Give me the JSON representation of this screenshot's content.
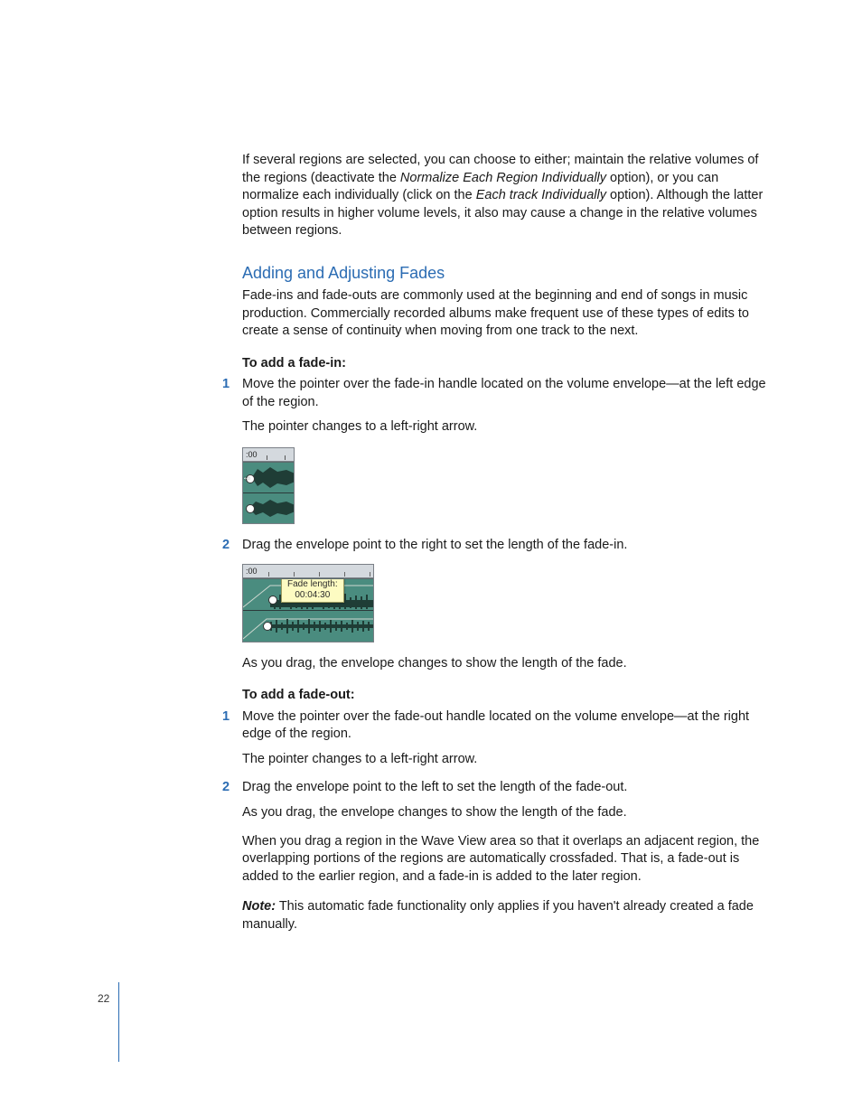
{
  "intro_para": {
    "t1": "If several regions are selected, you can choose to either; maintain the relative volumes of the regions (deactivate the ",
    "em1": "Normalize Each Region Individually",
    "t2": " option), or you can normalize each individually (click on the ",
    "em2": "Each track Individually",
    "t3": " option). Although the latter option results in higher volume levels, it also may cause a change in the relative volumes between regions."
  },
  "section_heading": "Adding and Adjusting Fades",
  "section_intro": "Fade-ins and fade-outs are commonly used at the beginning and end of songs in music production. Commercially recorded albums make frequent use of these types of edits to create a sense of continuity when moving from one track to the next.",
  "fadein_heading": "To add a fade-in:",
  "fadein_steps": [
    {
      "num": "1",
      "body": "Move the pointer over the fade-in handle located on the volume envelope—at the left edge of the region.",
      "after": "The pointer changes to a left-right arrow."
    },
    {
      "num": "2",
      "body": "Drag the envelope point to the right to set the length of the fade-in.",
      "after": "As you drag, the envelope changes to show the length of the fade."
    }
  ],
  "fig1": {
    "ruler_label": ":00"
  },
  "fig2": {
    "ruler_label": ":00",
    "tooltip_label": "Fade length:",
    "tooltip_value": "00:04:30"
  },
  "fadeout_heading": "To add a fade-out:",
  "fadeout_steps": [
    {
      "num": "1",
      "body": "Move the pointer over the fade-out handle located on the volume envelope—at the right edge of the region.",
      "after": "The pointer changes to a left-right arrow."
    },
    {
      "num": "2",
      "body": "Drag the envelope point to the left to set the length of the fade-out.",
      "after": "As you drag, the envelope changes to show the length of the fade."
    }
  ],
  "crossfade_para": "When you drag a region in the Wave View area so that it overlaps an adjacent region, the overlapping portions of the regions are automatically crossfaded. That is, a fade-out is added to the earlier region, and a fade-in is added to the later region.",
  "note_label": "Note:",
  "note_body": "  This automatic fade functionality only applies if you haven't already created a fade manually.",
  "page_number": "22"
}
